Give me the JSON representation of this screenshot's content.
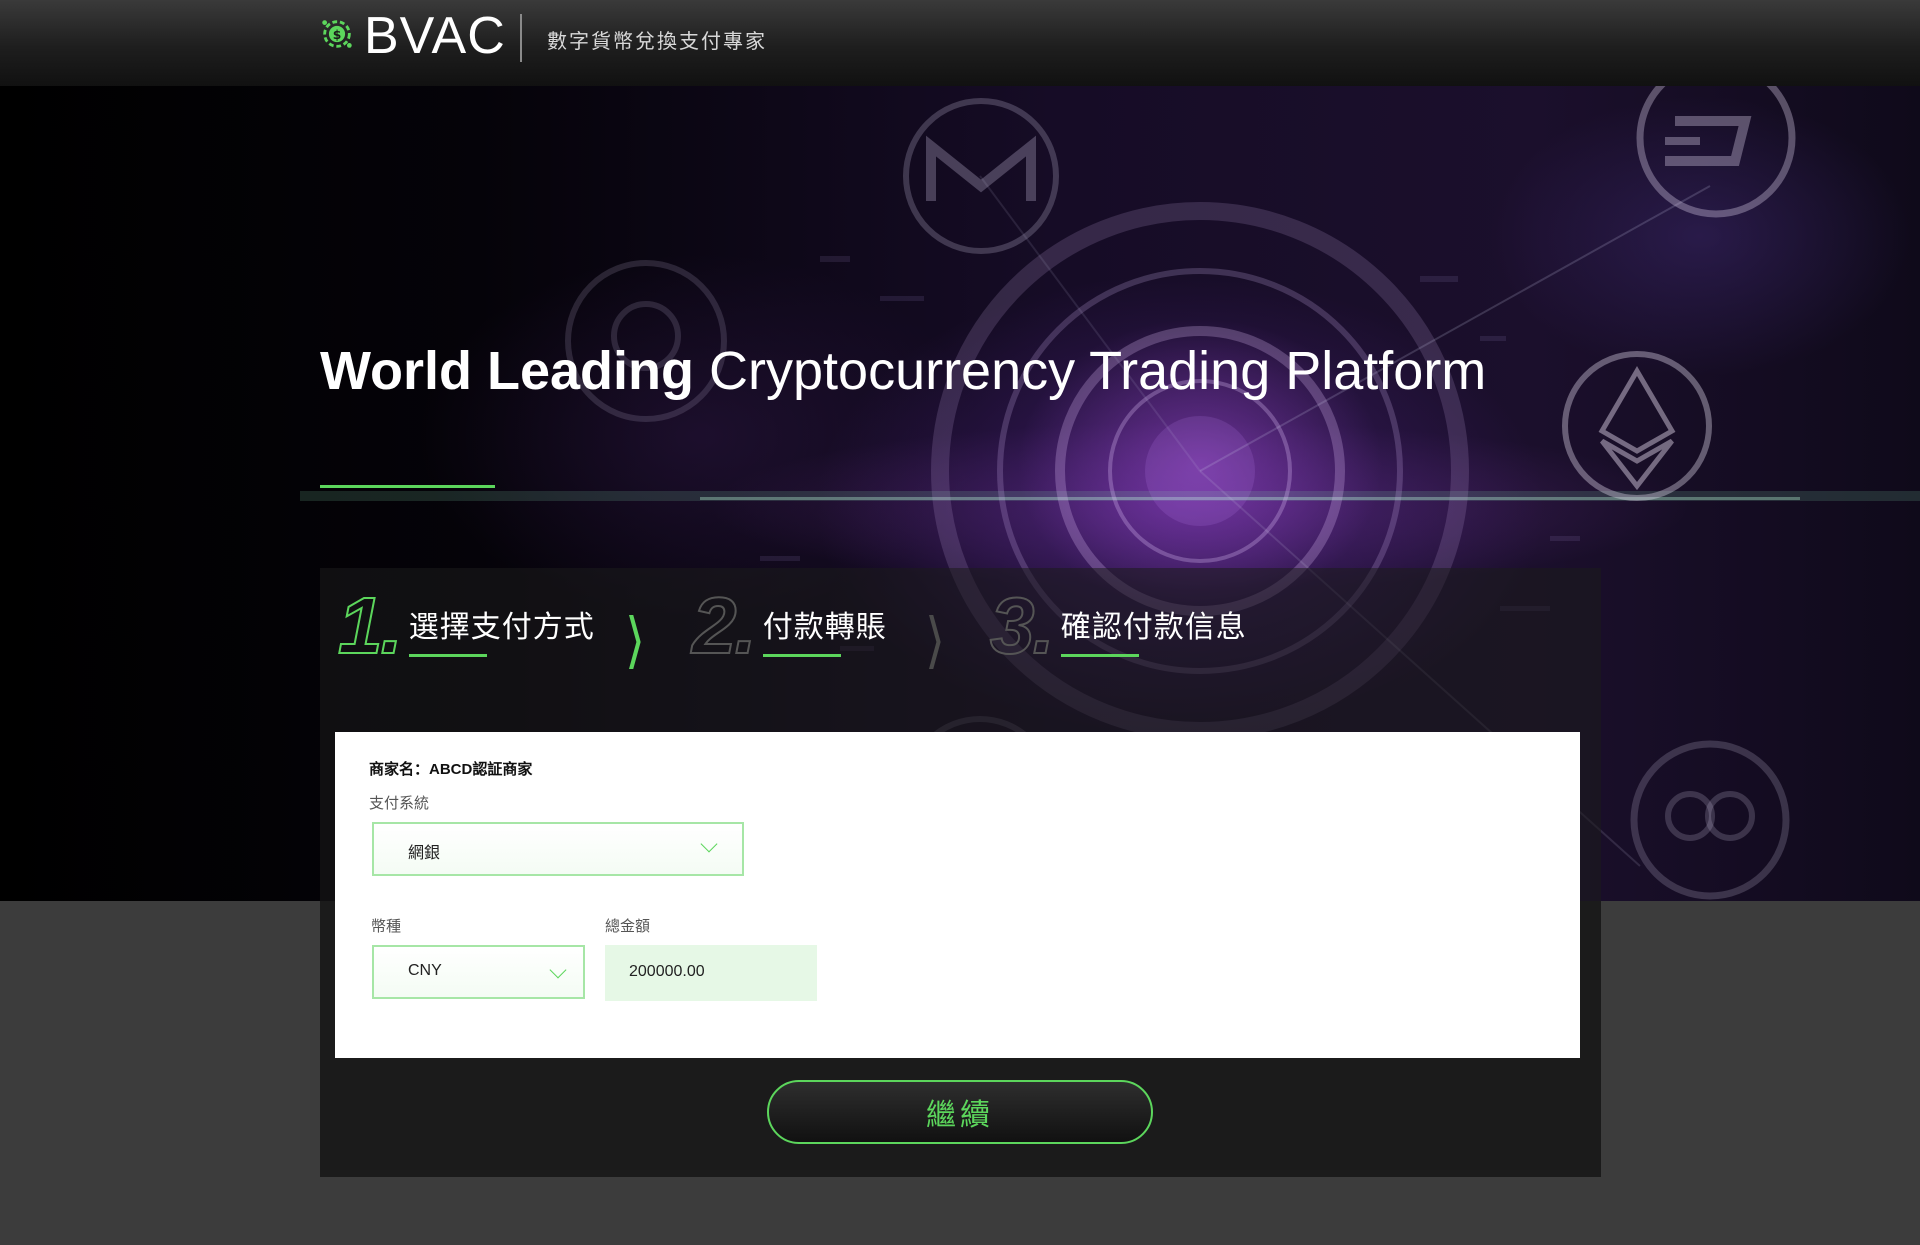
{
  "header": {
    "brand": "BVAC",
    "tagline": "數字貨幣兌換支付專家",
    "logo_icon": "dollar-gear-icon",
    "accent_color": "#5cd65c"
  },
  "hero": {
    "title_bold": "World Leading",
    "title_light": "Cryptocurrency Trading Platform",
    "background_icons": [
      "monero-icon",
      "dash-icon",
      "ethereum-icon",
      "ripple-icon",
      "litecoin-icon",
      "nem-icon"
    ]
  },
  "steps": [
    {
      "number": "1.",
      "label": "選擇支付方式",
      "active": true
    },
    {
      "number": "2.",
      "label": "付款轉賬",
      "active": false
    },
    {
      "number": "3.",
      "label": "確認付款信息",
      "active": false
    }
  ],
  "step_arrow": "❭",
  "form": {
    "merchant": "商家名：ABCD認証商家",
    "payment_system_label": "支付系統",
    "payment_system_value": "網銀",
    "currency_label": "幣種",
    "currency_value": "CNY",
    "amount_label": "總金額",
    "amount_value": "200000.00"
  },
  "continue_label": "繼續"
}
